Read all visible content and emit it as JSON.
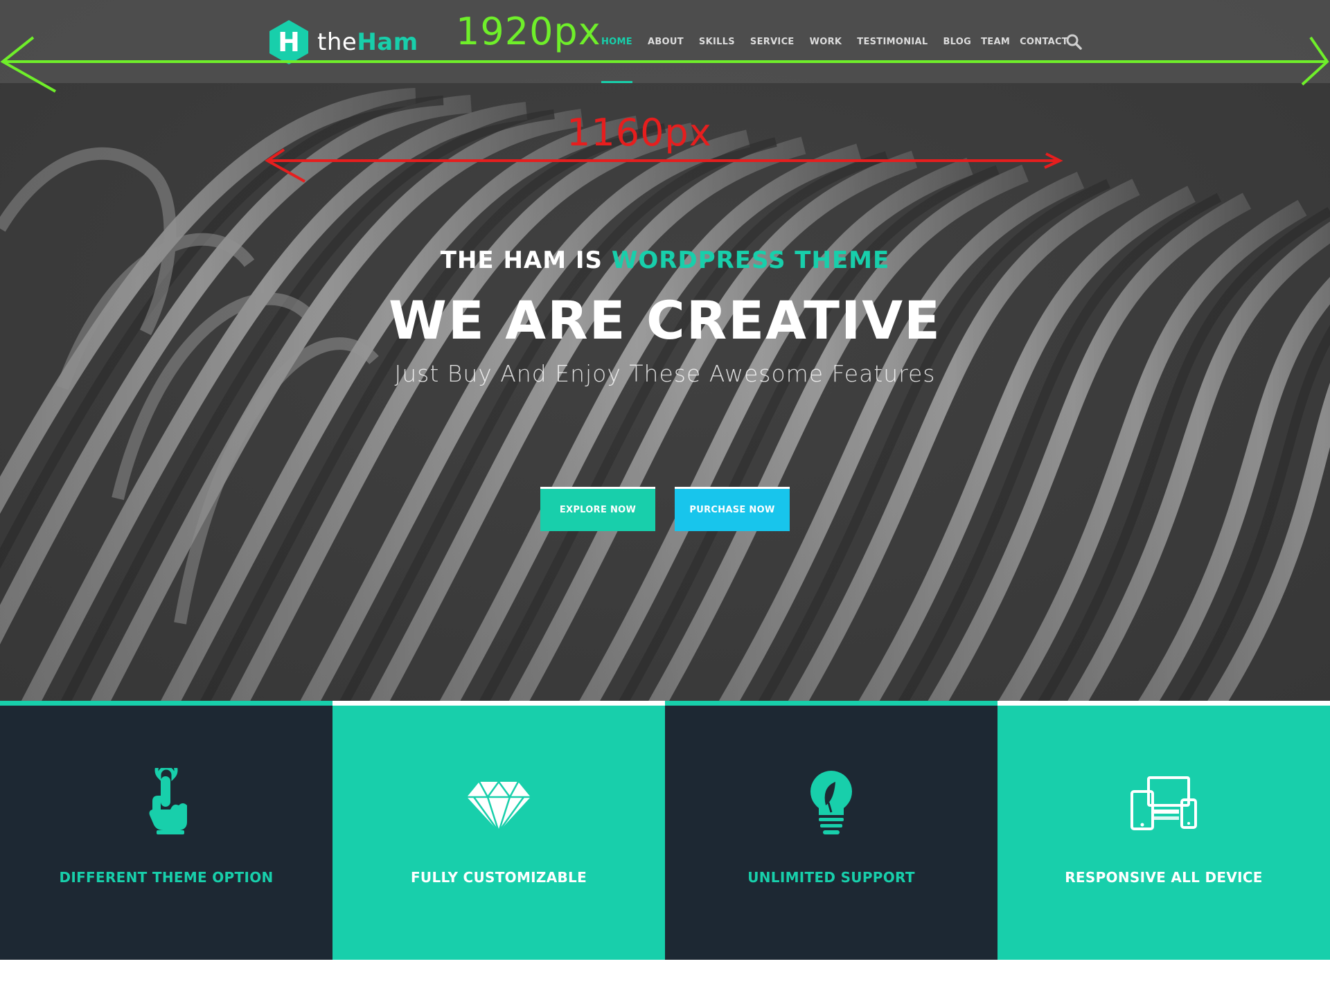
{
  "colors": {
    "accent": "#18cfab",
    "accent_blue": "#18c5ec",
    "dark": "#1d2833",
    "annotation_green": "#6fef2a",
    "annotation_red": "#e61e1e"
  },
  "header": {
    "logo": {
      "letter": "H",
      "text_plain": "the",
      "text_accent": "Ham"
    },
    "nav": [
      {
        "label": "HOME",
        "active": true
      },
      {
        "label": "ABOUT"
      },
      {
        "label": "SKILLS"
      },
      {
        "label": "SERVICE"
      },
      {
        "label": "WORK"
      },
      {
        "label": "TESTIMONIAL"
      },
      {
        "label": "BLOG"
      },
      {
        "label": "TEAM"
      },
      {
        "label": "CONTACT"
      }
    ],
    "search_icon": "search-icon"
  },
  "annotations": {
    "full_width_label": "1920px",
    "container_width_label": "1160px"
  },
  "hero": {
    "pre_plain": "THE HAM IS",
    "pre_accent": "WORDPRESS THEME",
    "title": "WE ARE CREATIVE",
    "subtitle": "Just Buy And Enjoy These Awesome Features",
    "buttons": {
      "explore": "EXPLORE NOW",
      "purchase": "PURCHASE NOW"
    }
  },
  "features": [
    {
      "label": "DIFFERENT THEME OPTION",
      "icon": "pointer-hand-icon"
    },
    {
      "label": "FULLY CUSTOMIZABLE",
      "icon": "diamond-icon"
    },
    {
      "label": "UNLIMITED SUPPORT",
      "icon": "lightbulb-icon"
    },
    {
      "label": "RESPONSIVE ALL DEVICE",
      "icon": "devices-icon"
    }
  ]
}
